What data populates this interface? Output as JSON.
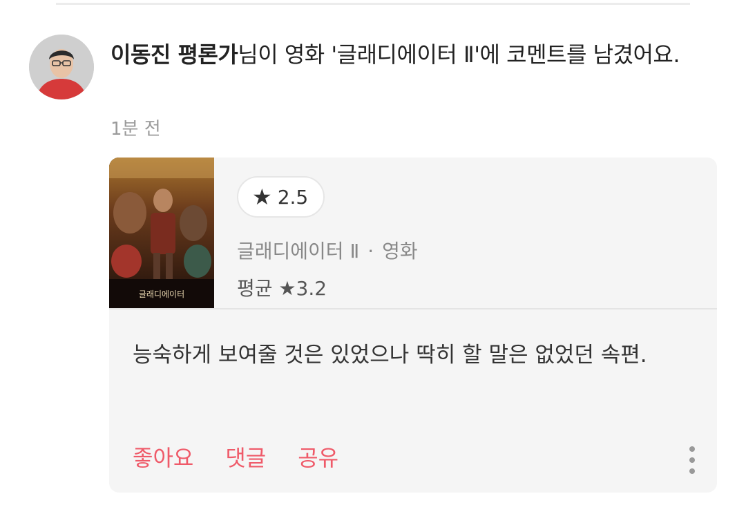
{
  "activity": {
    "user_name": "이동진 평론가",
    "message": "님이 영화 '글래디에이터 Ⅱ'에 코멘트를 남겼어요.",
    "time": "1분 전"
  },
  "card": {
    "rating": "2.5",
    "movie_title": "글래디에이터 Ⅱ",
    "separator": "·",
    "category": "영화",
    "average": "평균 ★3.2",
    "poster_title": "글래디에이터",
    "comment": "능숙하게 보여줄 것은 있었으나 딱히 할 말은 없었던 속편.",
    "actions": [
      "좋아요",
      "댓글",
      "공유"
    ]
  },
  "icons": {
    "star": "★"
  },
  "colors": {
    "accent": "#ef5a69",
    "card_bg": "#f5f5f5"
  }
}
